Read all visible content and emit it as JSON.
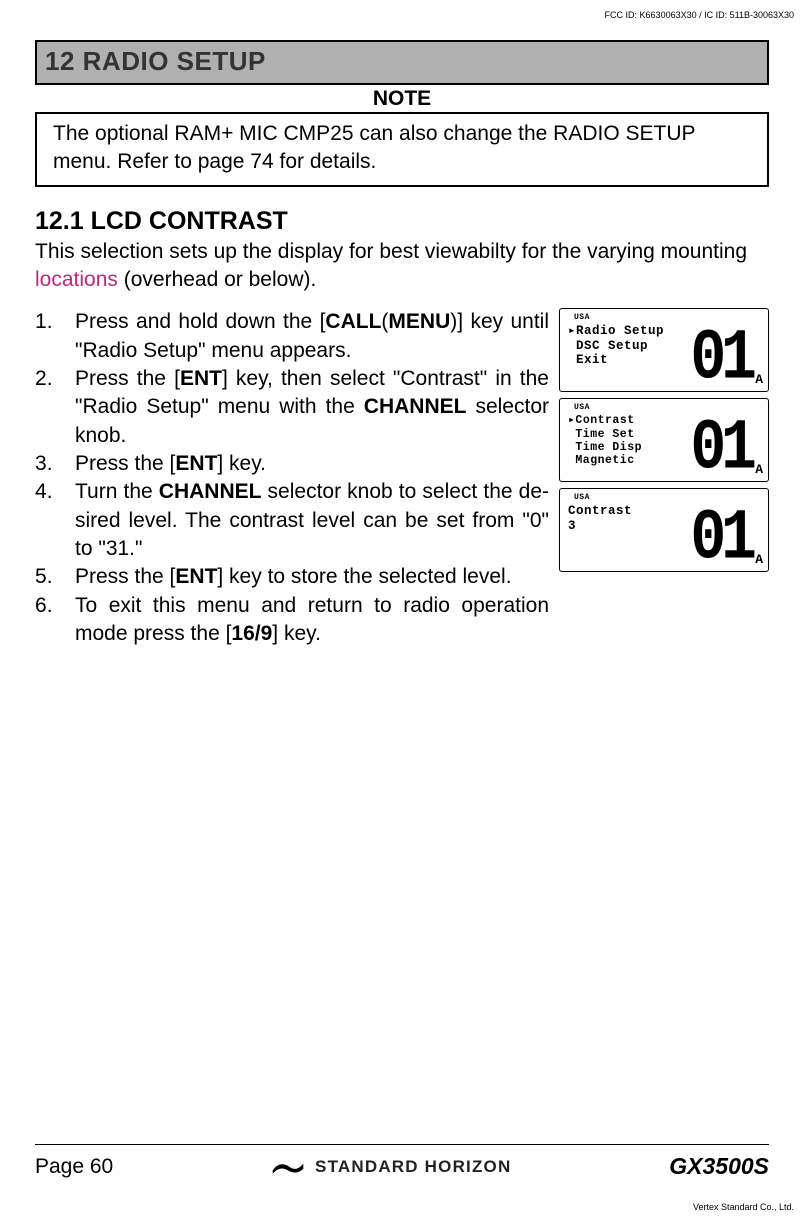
{
  "header": {
    "fcc": "FCC ID: K6630063X30 / IC ID: 511B-30063X30"
  },
  "section_bar": "12  RADIO SETUP",
  "note_heading": "NOTE",
  "note_body": "The optional RAM+ MIC CMP25 can also change the RADIO SETUP menu. Refer to page 74 for details.",
  "subsection": "12.1   LCD CONTRAST",
  "intro_prefix": "This selection sets up the display for best viewabilty for the varying mounting ",
  "intro_highlight": "locations",
  "intro_suffix": " (overhead or below).",
  "steps": {
    "s1a": "Press and hold down the [",
    "s1b": "CALL",
    "s1c": "(",
    "s1d": "MENU",
    "s1e": ")] key until \"",
    "s1f": "Radio Setup",
    "s1g": "\" menu appears.",
    "s2a": "Press the [",
    "s2b": "ENT",
    "s2c": "] key, then select \"",
    "s2d": "Contrast",
    "s2e": "\" in the \"",
    "s2f": "Radio Setup",
    "s2g": "\" menu with the ",
    "s2h": "CHANNEL",
    "s2i": " selector knob.",
    "s3a": "Press the [",
    "s3b": "ENT",
    "s3c": "] key.",
    "s4a": "Turn the ",
    "s4b": "CHANNEL",
    "s4c": " selector knob to select the de­sired level. The contrast level can be set from \"",
    "s4d": "0",
    "s4e": "\" to \"",
    "s4f": "31",
    "s4g": ".\"",
    "s5a": "Press the [",
    "s5b": "ENT",
    "s5c": "] key to store the selected level.",
    "s6a": "To exit this menu and return to radio operation mode press the [",
    "s6b": "16/9",
    "s6c": "] key."
  },
  "lcd": {
    "usa": "USA",
    "screen1": "▸Radio Setup\n DSC Setup\n Exit",
    "screen2": "▸Contrast\n Time Set\n Time Disp\n Magnetic",
    "screen3": "Contrast\n3",
    "digits": "01",
    "suffix": "A"
  },
  "footer": {
    "page": "Page 60",
    "brand": "STANDARD HORIZON",
    "model": "GX3500S",
    "vertex": "Vertex Standard Co., Ltd."
  }
}
